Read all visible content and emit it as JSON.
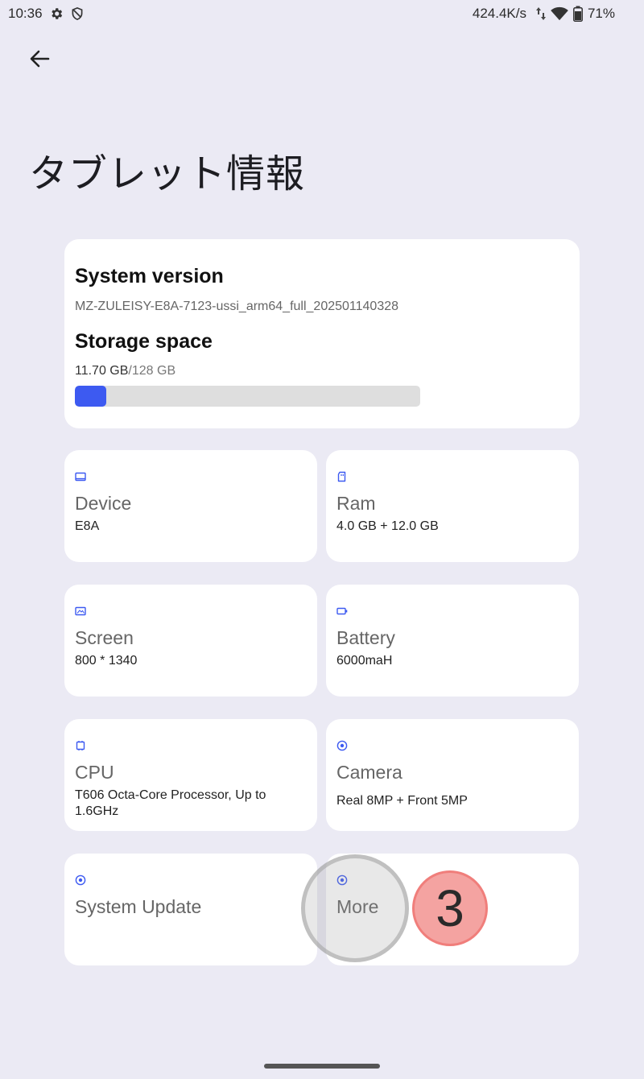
{
  "status_bar": {
    "time": "10:36",
    "net_speed": "424.4K/s",
    "battery": "71%",
    "icons": [
      "gear-icon",
      "shield-icon",
      "data-arrows-icon",
      "wifi-icon",
      "battery-icon"
    ]
  },
  "header": {
    "back_icon": "arrow-left-icon",
    "title": "タブレット情報"
  },
  "system_card": {
    "version_label": "System version",
    "version_value": "MZ-ZULEISY-E8A-7123-ussi_arm64_full_202501140328",
    "storage_label": "Storage space",
    "storage_used": "11.70 GB",
    "storage_total": "/128 GB",
    "storage_fraction": 0.0914,
    "storage_color": "#3d5af1"
  },
  "tiles": [
    {
      "label": "Device",
      "value": "E8A",
      "icon": "device-icon"
    },
    {
      "label": "Ram",
      "value": "4.0 GB + 12.0 GB",
      "icon": "ram-icon"
    },
    {
      "label": "Screen",
      "value": "800 * 1340",
      "icon": "screen-icon"
    },
    {
      "label": "Battery",
      "value": "6000maH",
      "icon": "battery-tile-icon"
    },
    {
      "label": "CPU",
      "value": "T606 Octa-Core Processor, Up to 1.6GHz",
      "icon": "cpu-icon"
    },
    {
      "label": "Camera",
      "value": "Real 8MP + Front 5MP",
      "icon": "camera-icon"
    },
    {
      "label": "System Update",
      "value": "",
      "icon": "update-icon"
    },
    {
      "label": "More",
      "value": "",
      "icon": "more-icon"
    }
  ],
  "overlay": {
    "step_number": "3"
  },
  "colors": {
    "accent": "#3d5af1",
    "background": "#ebeaf4",
    "card": "#ffffff"
  }
}
